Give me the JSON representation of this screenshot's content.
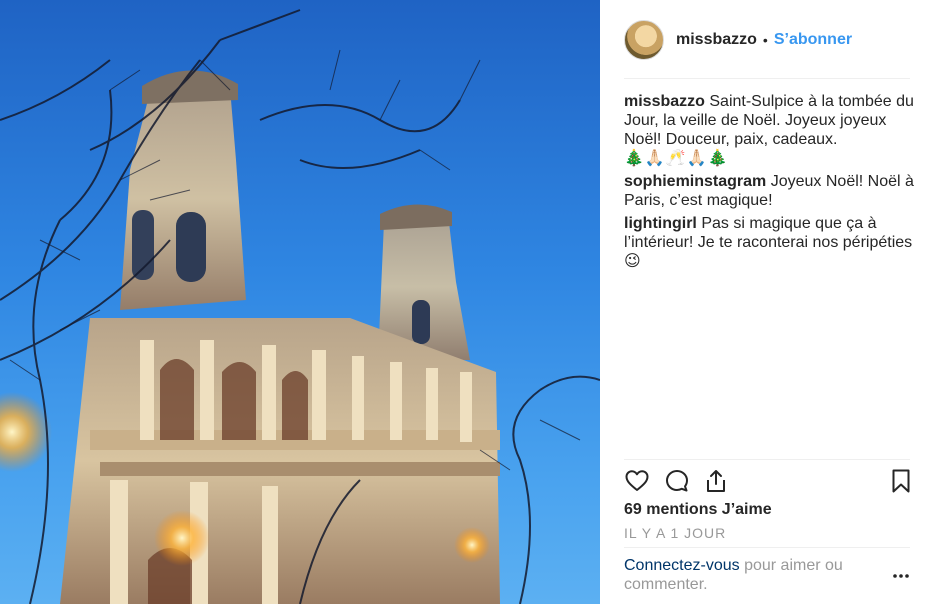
{
  "post": {
    "username": "missbazzo",
    "separator": "•",
    "follow_label": "S’abonner",
    "photo_alt": "Église Saint-Sulpice au crépuscule"
  },
  "comments": [
    {
      "author": "missbazzo",
      "text": "Saint-Sulpice à la tombée du Jour, la veille de Noël. Joyeux joyeux Noël! Douceur, paix, cadeaux.",
      "emoji": "🎄🙏🏻🥂🙏🏻🎄"
    },
    {
      "author": "sophieminstagram",
      "text": "Joyeux Noël! Noël à Paris, c’est magique!"
    },
    {
      "author": "lightingirl",
      "text": "Pas si magique que ça à l’intérieur! Je te raconterai nos péripéties 😉"
    }
  ],
  "actions": {
    "like_icon": "heart-icon",
    "comment_icon": "comment-icon",
    "share_icon": "share-icon",
    "save_icon": "bookmark-icon"
  },
  "likes_text": "69 mentions J’aime",
  "time_text": "IL Y A 1 JOUR",
  "login": {
    "link_text": "Connectez-vous",
    "rest_text": " pour aimer ou commenter."
  },
  "more_icon": "more-options-icon",
  "colors": {
    "accent": "#3897f0",
    "link_dark": "#003569",
    "muted": "#999999"
  }
}
